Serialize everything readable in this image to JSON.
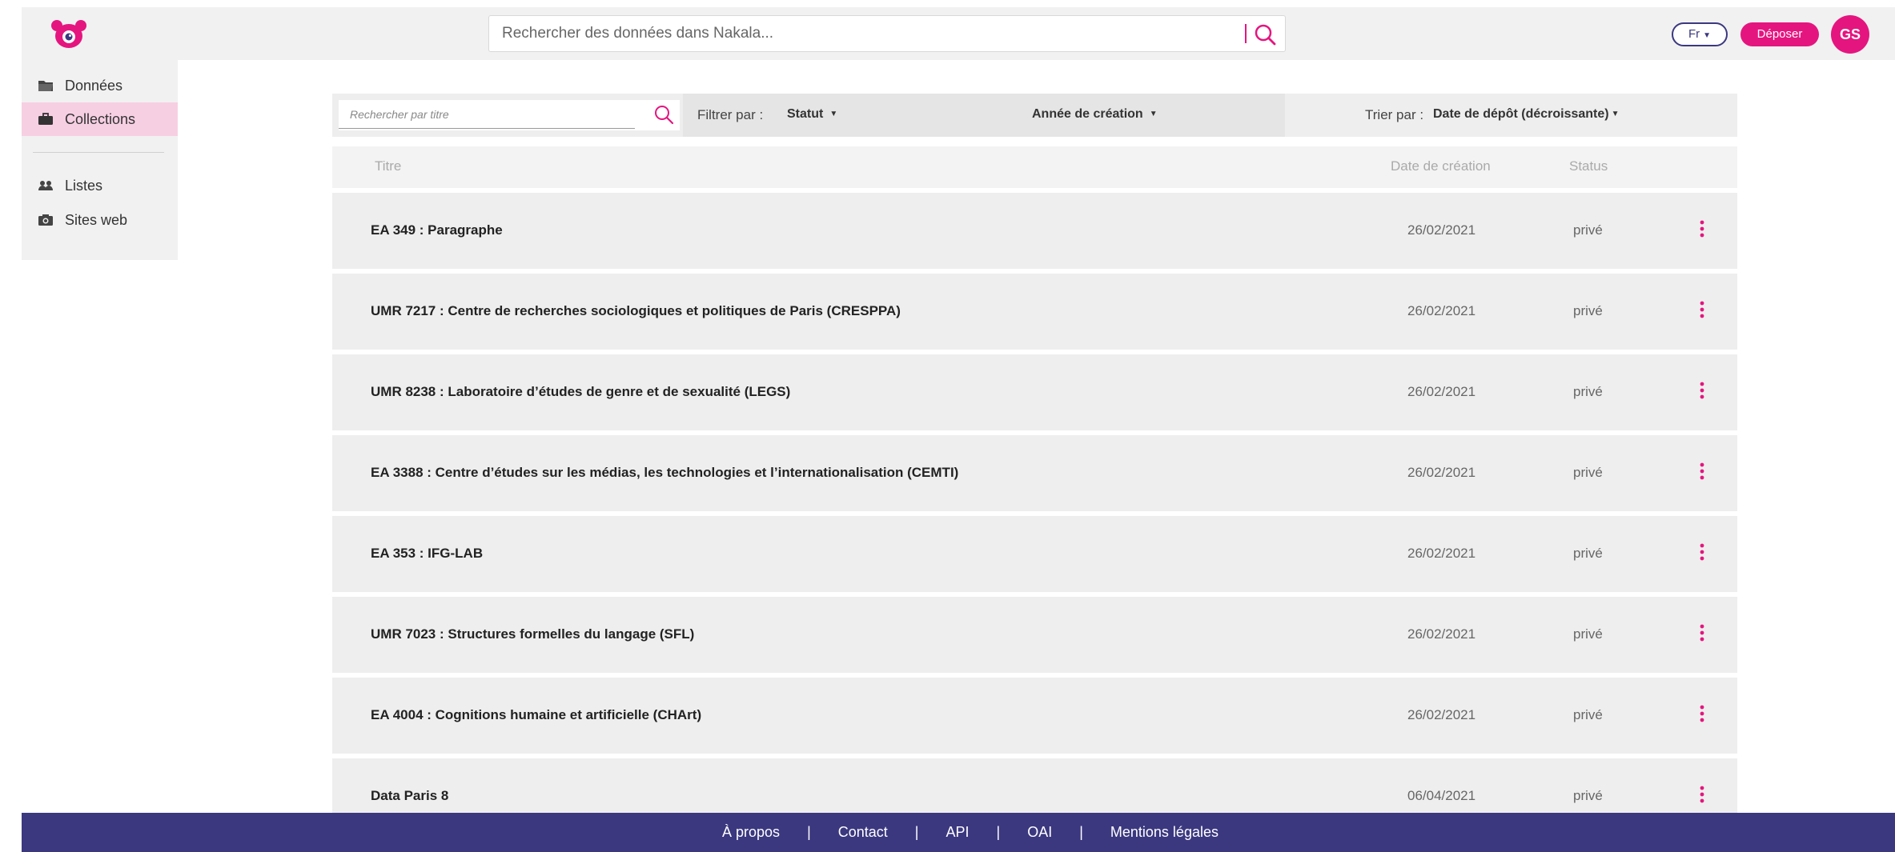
{
  "header": {
    "logo_icon": "nakala-bear-logo-icon",
    "search_placeholder": "Rechercher des données dans Nakala...",
    "search_icon": "search-icon",
    "lang_label": "Fr",
    "deposit_label": "Déposer",
    "avatar_initials": "GS",
    "accent_color": "#e5157f",
    "brand_color": "#3b3880"
  },
  "sidebar": {
    "items": [
      {
        "label": "Données",
        "icon": "folder-icon"
      },
      {
        "label": "Collections",
        "icon": "briefcase-icon",
        "active": true
      },
      {
        "label": "Listes",
        "icon": "users-icon"
      },
      {
        "label": "Sites web",
        "icon": "camera-icon"
      }
    ]
  },
  "filters": {
    "title_search_placeholder": "Rechercher par titre",
    "filter_label": "Filtrer par :",
    "status_label": "Statut",
    "year_label": "Année de création",
    "sort_label": "Trier par :",
    "sort_value": "Date de dépôt (décroissante)"
  },
  "table": {
    "columns": [
      "Titre",
      "Date de création",
      "Status"
    ],
    "rows": [
      {
        "title": "EA 349 : Paragraphe",
        "date": "26/02/2021",
        "status": "privé"
      },
      {
        "title": "UMR 7217 : Centre de recherches sociologiques et politiques de Paris (CRESPPA)",
        "date": "26/02/2021",
        "status": "privé"
      },
      {
        "title": "UMR 8238 : Laboratoire d’études de genre et de sexualité (LEGS)",
        "date": "26/02/2021",
        "status": "privé"
      },
      {
        "title": "EA 3388 : Centre d’études sur les médias, les technologies et l’internationalisation (CEMTI)",
        "date": "26/02/2021",
        "status": "privé"
      },
      {
        "title": "EA 353 : IFG-LAB",
        "date": "26/02/2021",
        "status": "privé"
      },
      {
        "title": "UMR 7023 : Structures formelles du langage (SFL)",
        "date": "26/02/2021",
        "status": "privé"
      },
      {
        "title": "EA 4004 : Cognitions humaine et artificielle (CHArt)",
        "date": "26/02/2021",
        "status": "privé"
      },
      {
        "title": "Data Paris 8",
        "date": "06/04/2021",
        "status": "privé"
      }
    ]
  },
  "footer": {
    "links": [
      "À propos",
      "Contact",
      "API",
      "OAI",
      "Mentions légales"
    ],
    "separator": "|"
  }
}
